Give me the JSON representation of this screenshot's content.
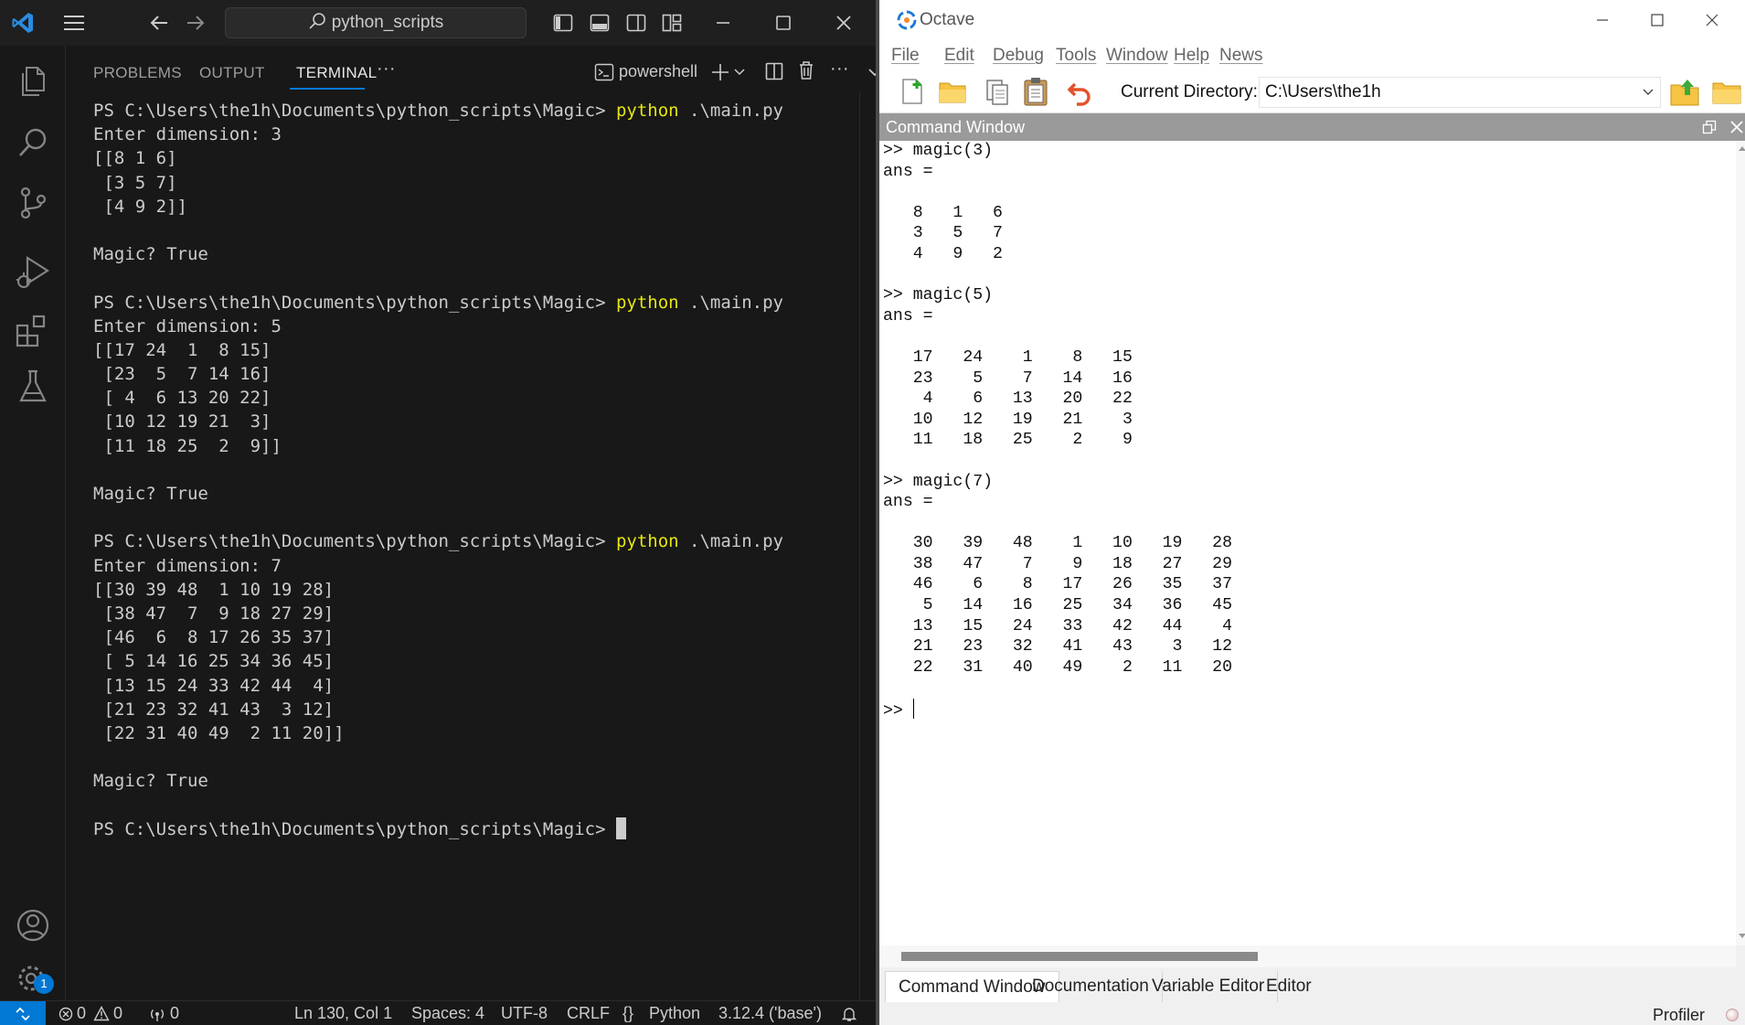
{
  "vscode": {
    "search": {
      "text": "python_scripts"
    },
    "panel_tabs": [
      "PROBLEMS",
      "OUTPUT",
      "TERMINAL"
    ],
    "more_label": "···",
    "terminal_name": "powershell",
    "terminal_lines": [
      [
        {
          "t": "PS C:\\Users\\the1h\\Documents\\python_scripts\\Magic> "
        },
        {
          "t": "python",
          "c": "cmd"
        },
        {
          "t": " .\\main.py"
        }
      ],
      [
        {
          "t": "Enter dimension: 3"
        }
      ],
      [
        {
          "t": "[[8 1 6]"
        }
      ],
      [
        {
          "t": " [3 5 7]"
        }
      ],
      [
        {
          "t": " [4 9 2]]"
        }
      ],
      [
        {
          "t": ""
        }
      ],
      [
        {
          "t": "Magic? True"
        }
      ],
      [
        {
          "t": ""
        }
      ],
      [
        {
          "t": "PS C:\\Users\\the1h\\Documents\\python_scripts\\Magic> "
        },
        {
          "t": "python",
          "c": "cmd"
        },
        {
          "t": " .\\main.py"
        }
      ],
      [
        {
          "t": "Enter dimension: 5"
        }
      ],
      [
        {
          "t": "[[17 24  1  8 15]"
        }
      ],
      [
        {
          "t": " [23  5  7 14 16]"
        }
      ],
      [
        {
          "t": " [ 4  6 13 20 22]"
        }
      ],
      [
        {
          "t": " [10 12 19 21  3]"
        }
      ],
      [
        {
          "t": " [11 18 25  2  9]]"
        }
      ],
      [
        {
          "t": ""
        }
      ],
      [
        {
          "t": "Magic? True"
        }
      ],
      [
        {
          "t": ""
        }
      ],
      [
        {
          "t": "PS C:\\Users\\the1h\\Documents\\python_scripts\\Magic> "
        },
        {
          "t": "python",
          "c": "cmd"
        },
        {
          "t": " .\\main.py"
        }
      ],
      [
        {
          "t": "Enter dimension: 7"
        }
      ],
      [
        {
          "t": "[[30 39 48  1 10 19 28]"
        }
      ],
      [
        {
          "t": " [38 47  7  9 18 27 29]"
        }
      ],
      [
        {
          "t": " [46  6  8 17 26 35 37]"
        }
      ],
      [
        {
          "t": " [ 5 14 16 25 34 36 45]"
        }
      ],
      [
        {
          "t": " [13 15 24 33 42 44  4]"
        }
      ],
      [
        {
          "t": " [21 23 32 41 43  3 12]"
        }
      ],
      [
        {
          "t": " [22 31 40 49  2 11 20]]"
        }
      ],
      [
        {
          "t": ""
        }
      ],
      [
        {
          "t": "Magic? True"
        }
      ],
      [
        {
          "t": ""
        }
      ],
      [
        {
          "t": "PS C:\\Users\\the1h\\Documents\\python_scripts\\Magic> "
        },
        {
          "t": "",
          "c": "cursor"
        }
      ]
    ],
    "status": {
      "errors": "0",
      "warnings": "0",
      "ports": "0",
      "position": "Ln 130, Col 1",
      "spaces": "Spaces: 4",
      "encoding": "UTF-8",
      "eol": "CRLF",
      "language_brace": "{}",
      "language": "Python",
      "interpreter": "3.12.4 ('base')"
    },
    "accounts_badge": "1"
  },
  "octave": {
    "title": "Octave",
    "menu": [
      "File",
      "Edit",
      "Debug",
      "Tools",
      "Window",
      "Help",
      "News"
    ],
    "current_directory_label": "Current Directory:",
    "current_directory": "C:\\Users\\the1h",
    "command_window_title": "Command Window",
    "console_lines": [
      ">> magic(3)",
      "ans =",
      "",
      "   8   1   6",
      "   3   5   7",
      "   4   9   2",
      "",
      ">> magic(5)",
      "ans =",
      "",
      "   17   24    1    8   15",
      "   23    5    7   14   16",
      "    4    6   13   20   22",
      "   10   12   19   21    3",
      "   11   18   25    2    9",
      "",
      ">> magic(7)",
      "ans =",
      "",
      "   30   39   48    1   10   19   28",
      "   38   47    7    9   18   27   29",
      "   46    6    8   17   26   35   37",
      "    5   14   16   25   34   36   45",
      "   13   15   24   33   42   44    4",
      "   21   23   32   41   43    3   12",
      "   22   31   40   49    2   11   20",
      ""
    ],
    "prompt": ">> ",
    "bottom_tabs": [
      "Command Window",
      "Documentation",
      "Variable Editor",
      "Editor"
    ],
    "profiler": "Profiler"
  }
}
